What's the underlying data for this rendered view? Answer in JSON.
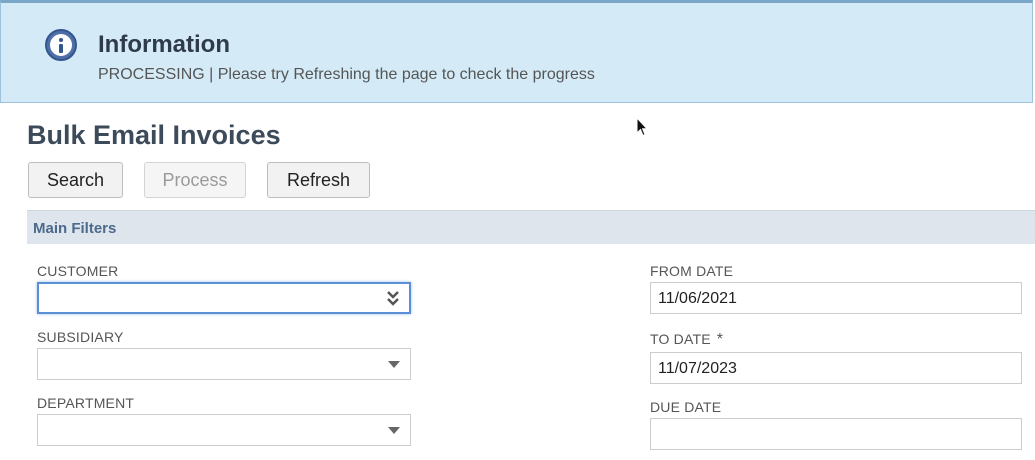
{
  "banner": {
    "icon": "info-icon",
    "title": "Information",
    "message": "PROCESSING | Please try Refreshing the page to check the progress"
  },
  "page": {
    "title": "Bulk Email Invoices"
  },
  "toolbar": {
    "search_label": "Search",
    "process_label": "Process",
    "refresh_label": "Refresh"
  },
  "filters": {
    "header": "Main Filters",
    "customer": {
      "label": "CUSTOMER",
      "value": ""
    },
    "subsidiary": {
      "label": "SUBSIDIARY",
      "value": ""
    },
    "department": {
      "label": "DEPARTMENT",
      "value": ""
    },
    "from_date": {
      "label": "FROM DATE",
      "value": "11/06/2021"
    },
    "to_date": {
      "label": "TO DATE",
      "required_mark": "*",
      "value": "11/07/2023"
    },
    "due_date": {
      "label": "DUE DATE",
      "value": ""
    }
  },
  "colors": {
    "banner_bg": "#d4ebf7",
    "info_icon": "#34568e",
    "section_header_bg": "#dfe5ec",
    "focus_border": "#5b8fd6"
  }
}
